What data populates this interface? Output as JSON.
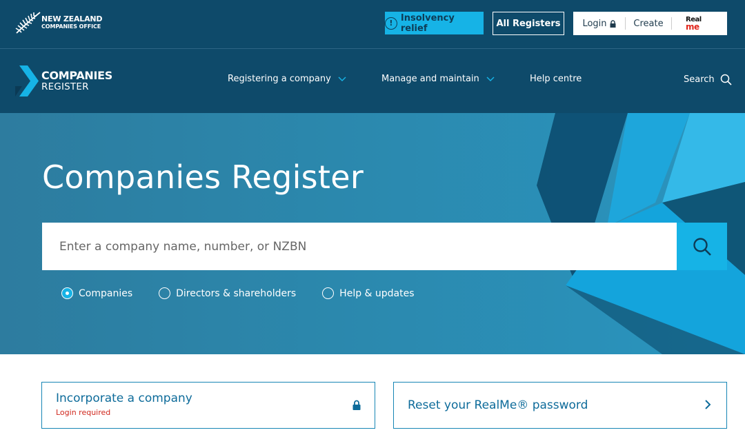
{
  "topbar": {
    "logo_line1": "NEW ZEALAND",
    "logo_line2": "COMPANIES OFFICE",
    "insolvency_label": "Insolvency relief",
    "registers_label": "All Registers",
    "login_label": "Login",
    "create_label": "Create",
    "realme_line1": "Real",
    "realme_line2": "me"
  },
  "nav": {
    "logo_line1": "COMPANIES",
    "logo_line2": "REGISTER",
    "items": [
      {
        "label": "Registering a company",
        "dropdown": true
      },
      {
        "label": "Manage and maintain",
        "dropdown": true
      },
      {
        "label": "Help centre",
        "dropdown": false
      }
    ],
    "search_label": "Search"
  },
  "hero": {
    "title": "Companies Register",
    "search_placeholder": "Enter a company name, number, or NZBN",
    "search_value": "",
    "radios": [
      {
        "label": "Companies",
        "selected": true
      },
      {
        "label": "Directors & shareholders",
        "selected": false
      },
      {
        "label": "Help & updates",
        "selected": false
      }
    ]
  },
  "cards": {
    "incorporate_title": "Incorporate a company",
    "incorporate_sub": "Login required",
    "reset_title": "Reset your RealMe® password"
  },
  "colors": {
    "navy": "#0e4a6a",
    "accent": "#16b3e6",
    "link": "#0d6b9a",
    "alert": "#d0271d"
  }
}
